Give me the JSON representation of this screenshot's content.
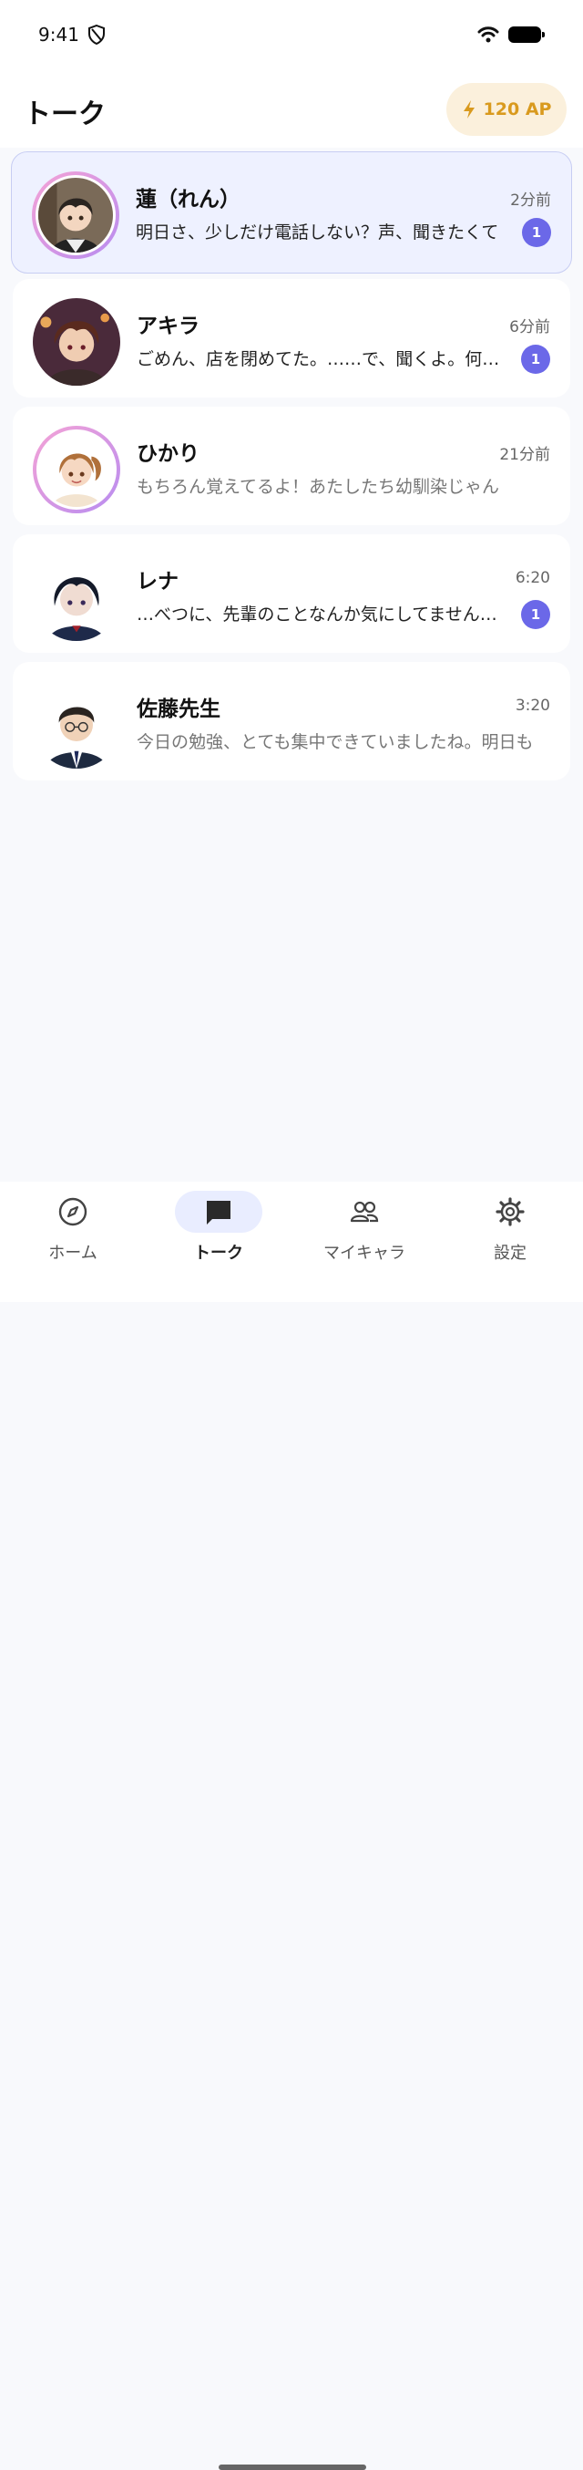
{
  "status_bar": {
    "time": "9:41"
  },
  "header": {
    "title": "トーク",
    "ap_label": "120 AP"
  },
  "chats": [
    {
      "name": "蓮（れん）",
      "time": "2分前",
      "preview": "明日さ、少しだけ電話しない？声、聞きたくて",
      "unread": "1",
      "active": true,
      "ring": true
    },
    {
      "name": "アキラ",
      "time": "6分前",
      "preview": "ごめん、店を閉めてた。……で、聞くよ。何があった？",
      "unread": "1",
      "active": false,
      "ring": false
    },
    {
      "name": "ひかり",
      "time": "21分前",
      "preview": "もちろん覚えてるよ！あたしたち幼馴染じゃん",
      "unread": "",
      "active": false,
      "ring": true
    },
    {
      "name": "レナ",
      "time": "6:20",
      "preview": "…べつに、先輩のことなんか気にしてませんけど",
      "unread": "1",
      "active": false,
      "ring": false
    },
    {
      "name": "佐藤先生",
      "time": "3:20",
      "preview": "今日の勉強、とても集中できていましたね。明日も",
      "unread": "",
      "active": false,
      "ring": false
    }
  ],
  "tabs": [
    {
      "label": "ホーム",
      "icon": "compass-icon"
    },
    {
      "label": "トーク",
      "icon": "chat-bubble-icon",
      "active": true
    },
    {
      "label": "マイキャラ",
      "icon": "people-icon"
    },
    {
      "label": "設定",
      "icon": "gear-icon"
    }
  ],
  "colors": {
    "accent": "#6b68e8",
    "ap_text": "#d99a1e",
    "ap_bg": "#fbf0dc",
    "active_card_bg": "#eef1ff"
  }
}
